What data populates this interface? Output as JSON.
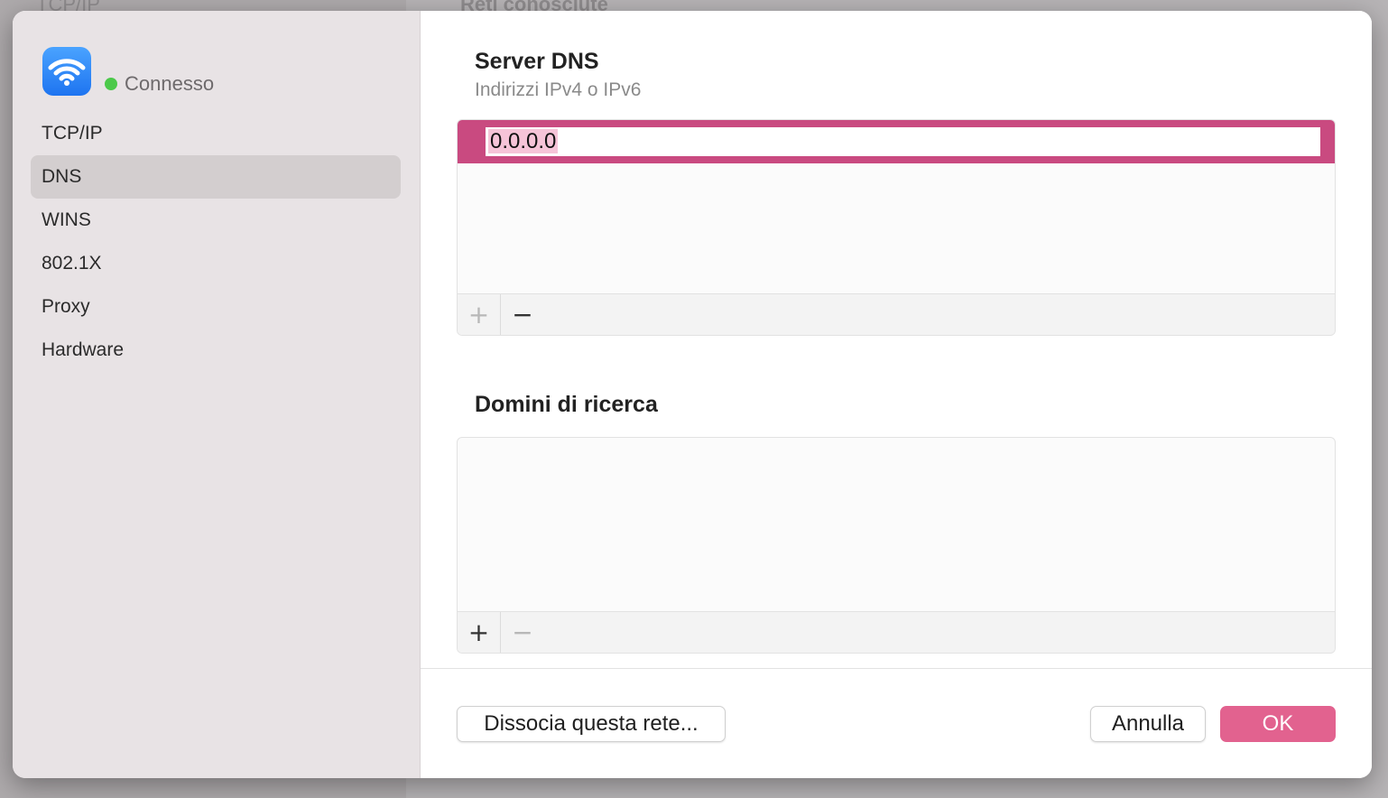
{
  "background": {
    "left_text": "TCP/IP",
    "right_text": "Reti conosciute"
  },
  "sidebar": {
    "status": "Connesso",
    "items": [
      {
        "label": "TCP/IP"
      },
      {
        "label": "DNS",
        "active": true
      },
      {
        "label": "WINS"
      },
      {
        "label": "802.1X"
      },
      {
        "label": "Proxy"
      },
      {
        "label": "Hardware"
      }
    ]
  },
  "dns": {
    "title": "Server DNS",
    "subtitle": "Indirizzi IPv4 o IPv6",
    "entries": [
      "0.0.0.0"
    ],
    "add_label": "+",
    "remove_label": "−"
  },
  "search_domains": {
    "title": "Domini di ricerca",
    "add_label": "+",
    "remove_label": "−"
  },
  "buttons": {
    "forget": "Dissocia questa rete...",
    "cancel": "Annulla",
    "ok": "OK"
  },
  "colors": {
    "accent": "#e2628f",
    "selection_row": "#c94a80",
    "status_connected": "#4cc94a"
  }
}
